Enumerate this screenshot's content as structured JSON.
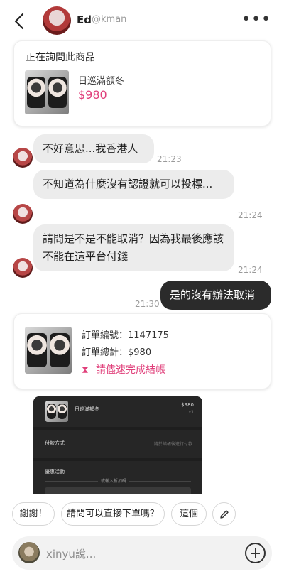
{
  "header": {
    "name": "Ed",
    "handle": "@kman",
    "more_icon": "more-horizontal-icon"
  },
  "inquiry": {
    "title": "正在詢問此商品",
    "product_name": "日巡滿額冬",
    "price": "$980"
  },
  "messages": [
    {
      "text": "不好意思...我香港人",
      "time": "21:23",
      "from": "other"
    },
    {
      "text": "不知道為什麼沒有認證就可以投標...",
      "time": "21:24",
      "from": "other"
    },
    {
      "text": "請問是不是不能取消？因為我最後應該不能在這平台付錢",
      "time": "21:24",
      "from": "other"
    },
    {
      "text": "是的沒有辦法取消",
      "time": "21:30",
      "from": "self"
    }
  ],
  "order": {
    "number_label": "訂單編號：1147175",
    "total_label": "訂單總計：$980",
    "warning": "請儘速完成結帳"
  },
  "screenshot": {
    "product": "日巡滿額冬",
    "price": "$980",
    "qty": "x1",
    "payment_label": "付款方式",
    "payment_hint": "將於結帳後進行付款",
    "promo_label": "優惠活動",
    "coupon_hint": "或輸入折扣碼"
  },
  "quick_replies": [
    "謝謝！",
    "請問可以直接下單嗎？",
    "這個"
  ],
  "input": {
    "placeholder": "xinyu說..."
  },
  "colors": {
    "accent": "#e0407b",
    "self_bubble": "#2b2b2b",
    "other_bubble": "#ececec"
  }
}
